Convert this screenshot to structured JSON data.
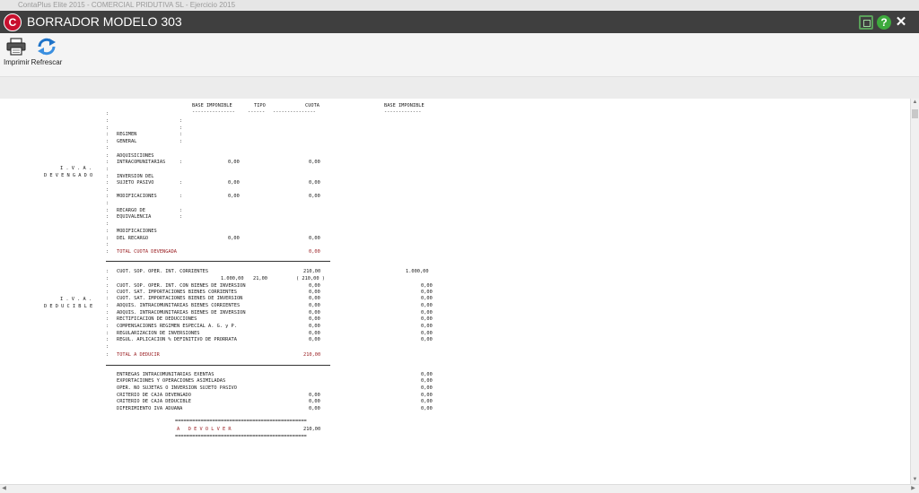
{
  "window": {
    "chrome_title": "ContaPlus Elite 2015 - COMERCIAL PRIDUTIVA SL - Ejercicio 2015",
    "title": "BORRADOR MODELO 303",
    "logo_letter": "C",
    "help_glyph": "?",
    "close_glyph": "✕"
  },
  "toolbar": {
    "print_label": "Imprimir",
    "refresh_label": "Refrescar"
  },
  "colors": {
    "titlebar": "#3f3f3f",
    "logo": "#c8102e",
    "total_text": "#9a1e22",
    "help": "#3daa3d"
  },
  "icons": [
    "printer-icon",
    "refresh-icon",
    "restore-window-icon",
    "help-icon",
    "close-icon"
  ],
  "report": {
    "header": {
      "base": "BASE IMPONIBLE",
      "tipo": "TIPO",
      "cuota": "CUOTA",
      "base2": "BASE IMPONIBLE",
      "u_base": "---------------",
      "u_tipo": "------",
      "u_cuota": "---------------",
      "u_base2": "-------------"
    },
    "labels": {
      "iva1": "I . V . A .",
      "devengado": "D E V E N G A D O",
      "iva2": "I . V . A .",
      "deducible": "D E D U C I B L E"
    },
    "devengado": {
      "regimen": "REGIMEN",
      "general": "GENERAL",
      "adq1": "ADQUISICIONES",
      "adq2": "INTRACOMUNITARIAS",
      "inv1": "INVERSION DEL",
      "inv2": "SUJETO PASIVO",
      "mod": "MODIFICACIONES",
      "rec1": "RECARGO DE",
      "rec2": "EQUIVALENCIA",
      "modr1": "MODIFICACIONES",
      "modr2": "DEL RECARGO",
      "adq_base": "0,00",
      "adq_cuota": "0,00",
      "inv_base": "0,00",
      "inv_cuota": "0,00",
      "mod_base": "0,00",
      "mod_cuota": "0,00",
      "modr_base": "0,00",
      "modr_cuota": "0,00",
      "total_label": "TOTAL CUOTA DEVENGADA",
      "total_value": "0,00"
    },
    "deducible": {
      "rows": [
        {
          "label": "CUOT. SOP. OPER. INT. CORRIENTES",
          "cuota": "210,00",
          "base2": "1.000,00"
        },
        {
          "label": "",
          "base": "1.000,00",
          "tipo": "21,00",
          "cuota": "( 210,00 )",
          "base2": ""
        },
        {
          "label": "CUOT. SOP. OPER. INT. CON BIENES DE INVERSION",
          "cuota": "0,00",
          "base2": "0,00"
        },
        {
          "label": "CUOT. SAT. IMPORTACIONES BIENES CORRIENTES",
          "cuota": "0,00",
          "base2": "0,00"
        },
        {
          "label": "CUOT. SAT. IMPORTACIONES BIENES DE INVERSION",
          "cuota": "0,00",
          "base2": "0,00"
        },
        {
          "label": "ADQUIS. INTRACOMUNITARIAS BIENES CORRIENTES",
          "cuota": "0,00",
          "base2": "0,00"
        },
        {
          "label": "ADQUIS. INTRACOMUNITARIAS BIENES DE INVERSION",
          "cuota": "0,00",
          "base2": "0,00"
        },
        {
          "label": "RECTIFICACION DE DEDUCCIONES",
          "cuota": "0,00",
          "base2": "0,00"
        },
        {
          "label": "COMPENSACIONES REGIMEN ESPECIAL A. G. y P.",
          "cuota": "0,00",
          "base2": "0,00"
        },
        {
          "label": "REGULARIZACION DE INVERSIONES",
          "cuota": "0,00",
          "base2": "0,00"
        },
        {
          "label": "REGUL. APLICACION % DEFINITIVO DE PRORRATA",
          "cuota": "0,00",
          "base2": "0,00"
        }
      ],
      "total_label": "TOTAL A DEDUCIR",
      "total_value": "210,00"
    },
    "otros": [
      {
        "label": "ENTREGAS INTRACOMUNITARIAS EXENTAS",
        "cuota": "",
        "base2": "0,00"
      },
      {
        "label": "EXPORTACIONES Y OPERACIONES ASIMILADAS",
        "cuota": "",
        "base2": "0,00"
      },
      {
        "label": "OPER. NO SUJETAS O INVERSION SUJETO PASIVO",
        "cuota": "",
        "base2": "0,00"
      },
      {
        "label": "CRITERIO DE CAJA DEVENGADO",
        "cuota": "0,00",
        "base2": "0,00"
      },
      {
        "label": "CRITERIO DE CAJA DEDUCIBLE",
        "cuota": "0,00",
        "base2": "0,00"
      },
      {
        "label": "DIFERIMIENTO IVA ADUANA",
        "cuota": "0,00",
        "base2": "0,00"
      }
    ],
    "result": {
      "eq_line": "==============================================",
      "label": "A   D E V O L V E R",
      "value": "210,00"
    }
  }
}
